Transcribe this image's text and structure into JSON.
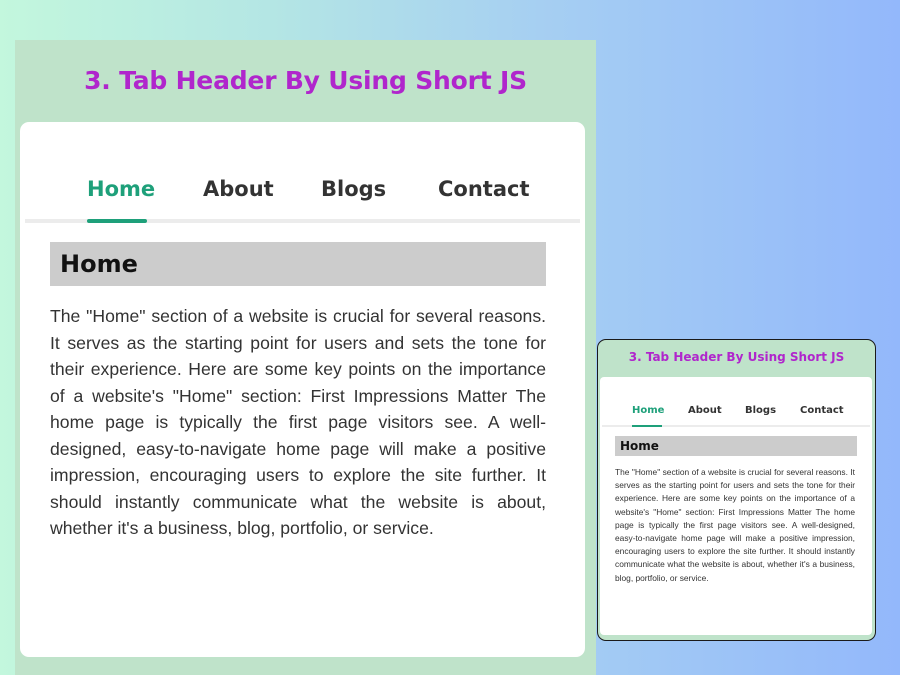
{
  "title": "3. Tab Header By Using Short JS",
  "tabs": [
    {
      "label": "Home",
      "active": true
    },
    {
      "label": "About",
      "active": false
    },
    {
      "label": "Blogs",
      "active": false
    },
    {
      "label": "Contact",
      "active": false
    }
  ],
  "content": {
    "heading": "Home",
    "body": "The \"Home\" section of a website is crucial for several reasons. It serves as the starting point for users and sets the tone for their experience. Here are some key points on the importance of a website's \"Home\" section: First Impressions Matter The home page is typically the first page visitors see. A well-designed, easy-to-navigate home page will make a positive impression, encouraging users to explore the site further. It should instantly communicate what the website is about, whether it's a business, blog, portfolio, or service."
  },
  "colors": {
    "title": "#b026cc",
    "active_tab": "#1ea07a",
    "heading_bg": "#cccccc",
    "panel_bg": "#bfe3ca"
  }
}
